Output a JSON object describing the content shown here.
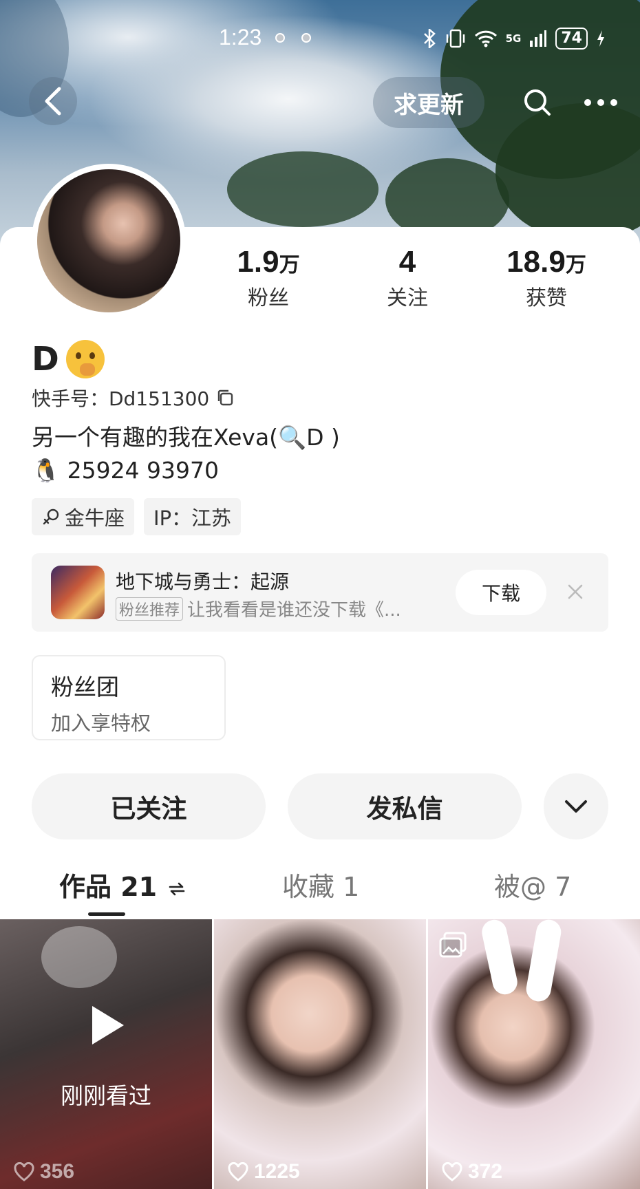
{
  "status_bar": {
    "time": "1:23",
    "network": "5G",
    "battery": "74"
  },
  "header": {
    "update_label": "求更新"
  },
  "stats": [
    {
      "num": "1.9",
      "unit": "万",
      "label": "粉丝"
    },
    {
      "num": "4",
      "unit": "",
      "label": "关注"
    },
    {
      "num": "18.9",
      "unit": "万",
      "label": "获赞"
    }
  ],
  "profile": {
    "name": "D",
    "kuaishou_id": "快手号：Dd151300",
    "bio_line1": "另一个有趣的我在Xeva(🔍D )",
    "bio_line2": "🐧 25924 93970",
    "tags": [
      "金牛座",
      "IP：江苏"
    ]
  },
  "ad": {
    "title": "地下城与勇士：起源",
    "badge": "粉丝推荐",
    "subtitle": "让我看看是谁还没下载《...",
    "download_label": "下载"
  },
  "fan_club": {
    "title": "粉丝团",
    "subtitle": "加入享特权"
  },
  "actions": {
    "follow_label": "已关注",
    "message_label": "发私信"
  },
  "tabs": [
    {
      "label": "作品 21",
      "active": true
    },
    {
      "label": "收藏 1",
      "active": false
    },
    {
      "label": "被@ 7",
      "active": false
    }
  ],
  "videos": [
    {
      "likes": "356",
      "overlay": "刚刚看过"
    },
    {
      "likes": "1225"
    },
    {
      "likes": "372"
    }
  ],
  "icons": {
    "back": "back-arrow-icon",
    "search": "search-icon",
    "more": "more-dots-icon",
    "copy": "copy-icon",
    "dropdown": "chevron-down-icon",
    "like": "heart-icon",
    "play": "play-icon",
    "multi_image": "image-icon",
    "close": "close-icon",
    "switch": "switch-arrows-icon"
  }
}
